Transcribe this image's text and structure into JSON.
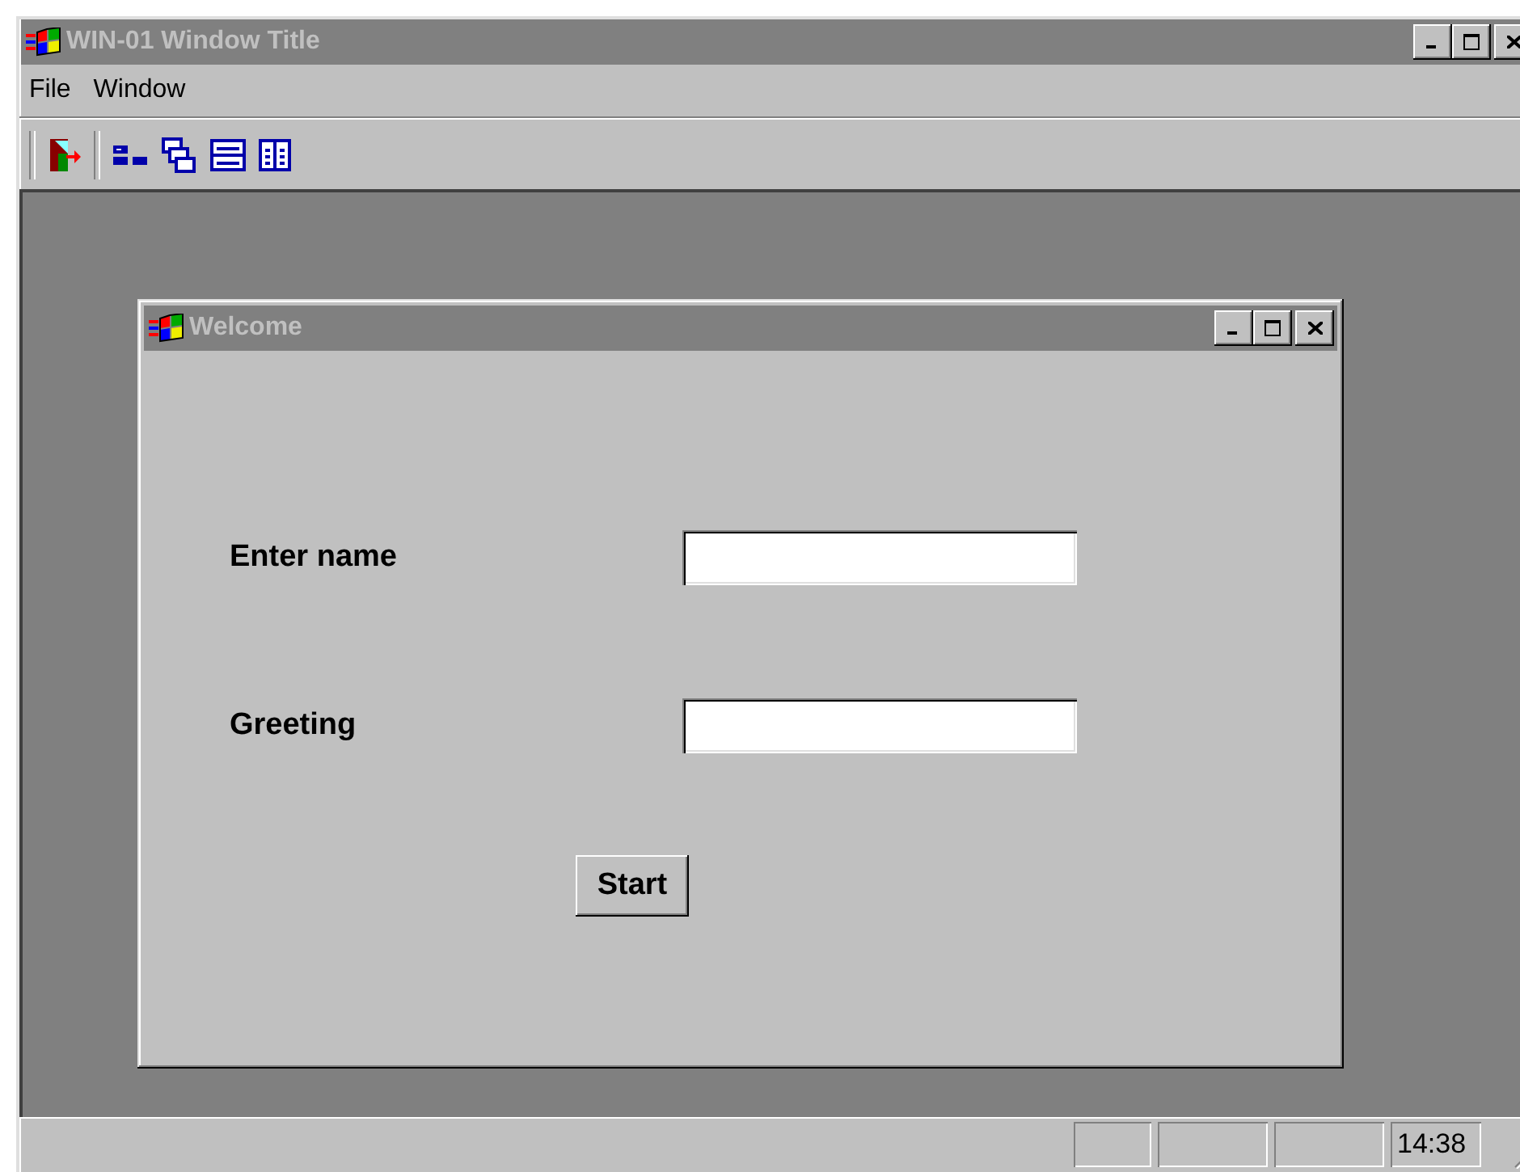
{
  "window": {
    "title": "WIN-01 Window Title",
    "active": false
  },
  "menu": [
    {
      "label": "File"
    },
    {
      "label": "Window"
    }
  ],
  "toolbar": [
    {
      "kind": "exit"
    },
    {
      "kind": "separator"
    },
    {
      "kind": "icons"
    },
    {
      "kind": "cascade"
    },
    {
      "kind": "tile-h"
    },
    {
      "kind": "tile-v"
    }
  ],
  "child_window": {
    "title": "Welcome",
    "active": false,
    "fields": [
      {
        "label": "Enter name"
      },
      {
        "label": "Greeting"
      }
    ],
    "button": "Start"
  },
  "status_bar": {
    "time": "14:38"
  }
}
